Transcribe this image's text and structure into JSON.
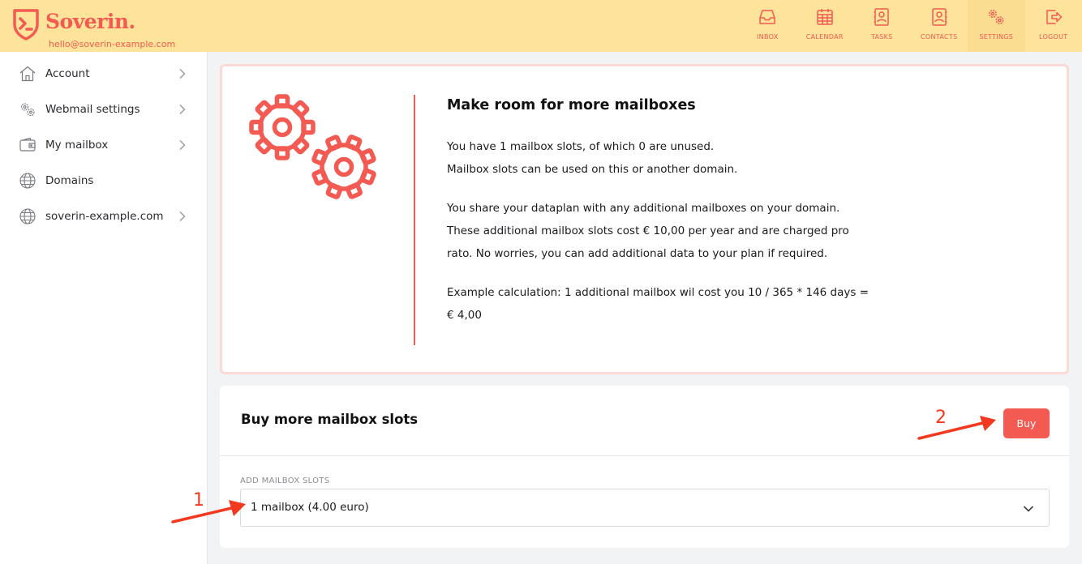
{
  "brand": {
    "name": "Soverin.",
    "email": "hello@soverin-example.com",
    "accent": "#f25a52",
    "header_bg": "#fde49a"
  },
  "nav": {
    "items": [
      {
        "label": "INBOX",
        "icon": "inbox-icon"
      },
      {
        "label": "CALENDAR",
        "icon": "calendar-icon"
      },
      {
        "label": "TASKS",
        "icon": "tasks-icon"
      },
      {
        "label": "CONTACTS",
        "icon": "contacts-icon"
      },
      {
        "label": "SETTINGS",
        "icon": "settings-icon",
        "active": true
      },
      {
        "label": "LOGOUT",
        "icon": "logout-icon"
      }
    ]
  },
  "sidebar": {
    "items": [
      {
        "label": "Account",
        "icon": "home-icon",
        "has_chevron": true
      },
      {
        "label": "Webmail settings",
        "icon": "gears-icon",
        "has_chevron": true
      },
      {
        "label": "My mailbox",
        "icon": "wallet-icon",
        "has_chevron": true
      },
      {
        "label": "Domains",
        "icon": "globe-icon",
        "has_chevron": false
      },
      {
        "label": "soverin-example.com",
        "icon": "globe-icon",
        "has_chevron": true
      }
    ]
  },
  "info": {
    "title": "Make room for more mailboxes",
    "p1_line1": "You have 1 mailbox slots, of which 0 are unused.",
    "p1_line2": "Mailbox slots can be used on this or another domain.",
    "p2_line1": "You share your dataplan with any additional mailboxes on your domain.",
    "p2_line2": "These additional mailbox slots cost € 10,00 per year and are charged pro",
    "p2_line3": "rato. No worries, you can add additional data to your plan if required.",
    "p3_line1": "Example calculation: 1 additional mailbox wil cost you 10 / 365 * 146 days =",
    "p3_line2": "€ 4,00"
  },
  "buy": {
    "title": "Buy more mailbox slots",
    "button_label": "Buy",
    "field_label": "ADD MAILBOX SLOTS",
    "selected_option": "1 mailbox (4.00 euro)"
  },
  "annotations": {
    "one": "1",
    "two": "2",
    "color": "#f2391f"
  }
}
